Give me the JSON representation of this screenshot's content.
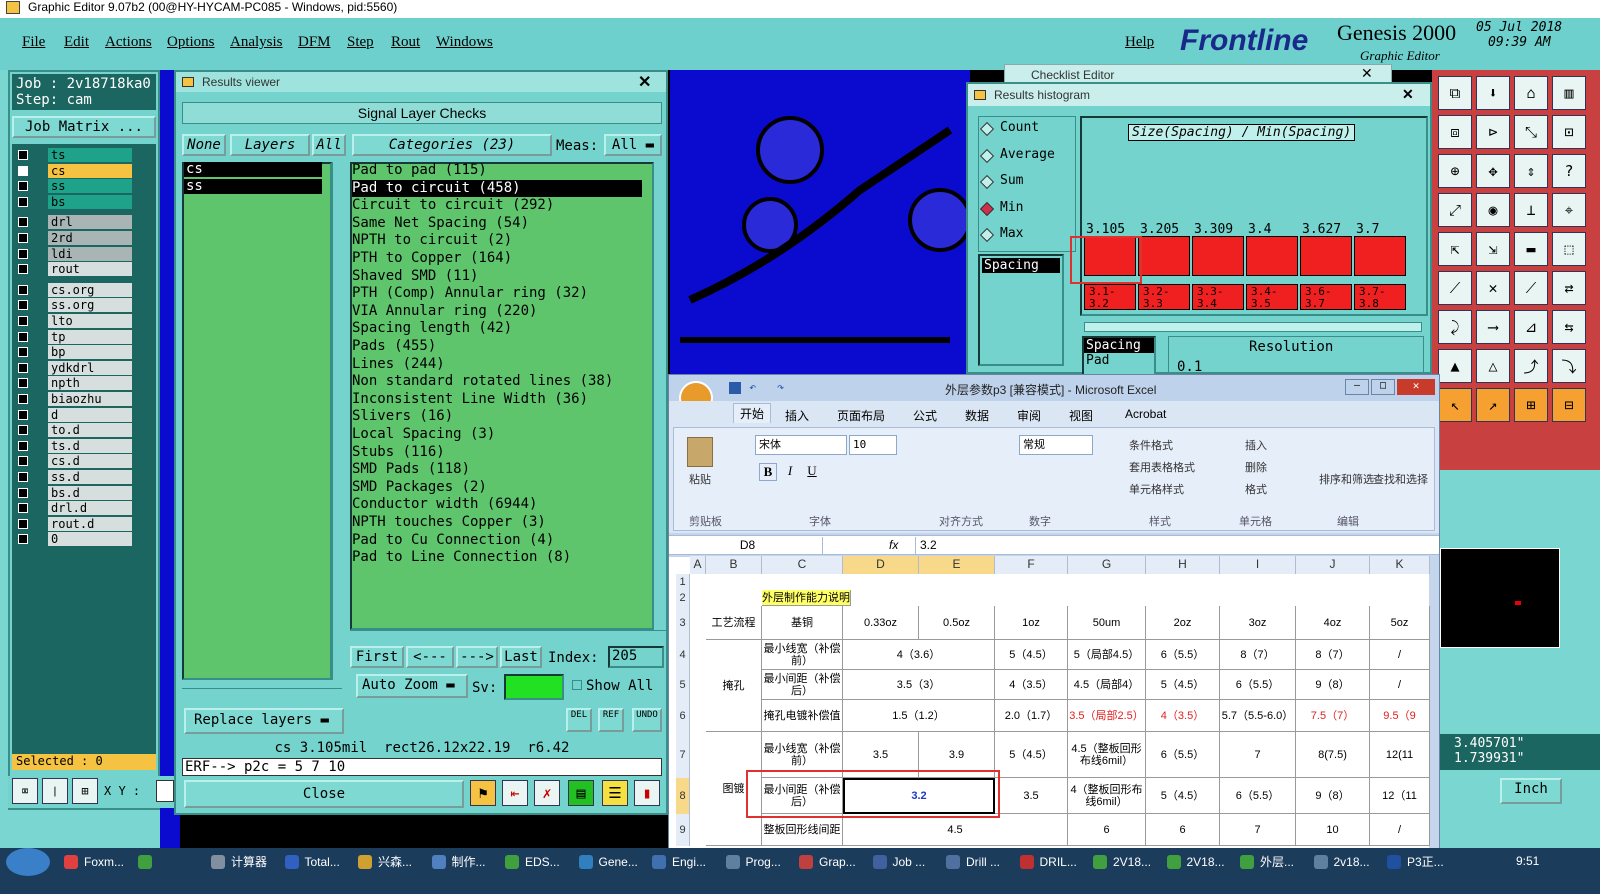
{
  "titlebar": {
    "text": "Graphic Editor 9.07b2 (00@HY-HYCAM-PC085 - Windows, pid:5560)"
  },
  "menu": {
    "items": [
      "File",
      "Edit",
      "Actions",
      "Options",
      "Analysis",
      "DFM",
      "Step",
      "Rout",
      "Windows"
    ],
    "help": "Help"
  },
  "brand": {
    "logo": "Frontline",
    "product": "Genesis 2000",
    "sub": "Graphic Editor",
    "date": "05 Jul 2018",
    "time": "09:39 AM"
  },
  "job": {
    "job_label": "Job : 2v18718ka0",
    "step_label": "Step: cam",
    "matrix_btn": "Job Matrix ...",
    "selected": "Selected : 0",
    "xy": "X Y :"
  },
  "layers": [
    {
      "name": "ts",
      "color": "#1fa28a"
    },
    {
      "name": "cs",
      "color": "#f5c242"
    },
    {
      "name": "ss",
      "color": "#1fa28a"
    },
    {
      "name": "bs",
      "color": "#1fa28a"
    },
    {
      "name": "drl",
      "color": "#a9b4b4"
    },
    {
      "name": "2rd",
      "color": "#a9b4b4"
    },
    {
      "name": "ldi",
      "color": "#a9b4b4"
    },
    {
      "name": "rout",
      "color": "#d6dede"
    },
    {
      "name": "cs.org",
      "color": "#d6dede"
    },
    {
      "name": "ss.org",
      "color": "#d6dede"
    },
    {
      "name": "lto",
      "color": "#d6dede"
    },
    {
      "name": "tp",
      "color": "#d6dede"
    },
    {
      "name": "bp",
      "color": "#d6dede"
    },
    {
      "name": "ydkdrl",
      "color": "#d6dede"
    },
    {
      "name": "npth",
      "color": "#d6dede"
    },
    {
      "name": "biaozhu",
      "color": "#d6dede"
    },
    {
      "name": "d",
      "color": "#d6dede"
    },
    {
      "name": "to.d",
      "color": "#d6dede"
    },
    {
      "name": "ts.d",
      "color": "#d6dede"
    },
    {
      "name": "cs.d",
      "color": "#d6dede"
    },
    {
      "name": "ss.d",
      "color": "#d6dede"
    },
    {
      "name": "bs.d",
      "color": "#d6dede"
    },
    {
      "name": "drl.d",
      "color": "#d6dede"
    },
    {
      "name": "rout.d",
      "color": "#d6dede"
    },
    {
      "name": "0",
      "color": "#d6dede"
    }
  ],
  "results": {
    "title": "Results viewer",
    "heading": "Signal Layer Checks",
    "none_btn": "None",
    "layers_btn": "Layers",
    "all_btn": "All",
    "categories_btn": "Categories (23)",
    "meas_label": "Meas:",
    "meas_value": "All",
    "layer_list": [
      "cs",
      "ss"
    ],
    "categories": [
      "Pad to pad (115)",
      "Pad to circuit (458)",
      "Circuit to circuit (292)",
      "Same Net Spacing (54)",
      "NPTH to circuit (2)",
      "PTH to Copper (164)",
      "Shaved SMD (11)",
      "PTH (Comp) Annular ring (32)",
      "VIA Annular ring (220)",
      "Spacing length (42)",
      "Pads (455)",
      "Lines (244)",
      "Non standard rotated lines (38)",
      "Inconsistent Line Width (36)",
      "Slivers (16)",
      "Local Spacing (3)",
      "Stubs (116)",
      "SMD Pads (118)",
      "SMD Packages (2)",
      "Conductor width (6944)",
      "NPTH touches Copper (3)",
      "Pad to Cu Connection (4)",
      "Pad to Line Connection (8)"
    ],
    "first": "First",
    "prev": "<---",
    "next": "--->",
    "last": "Last",
    "index_label": "Index:",
    "index_value": "205",
    "auto_zoom": "Auto Zoom",
    "sv": "Sv:",
    "show_all": "Show All",
    "replace_layers": "Replace layers",
    "status": "cs 3.105mil  rect26.12x22.19  r6.42",
    "erf": "ERF--> p2c = 5 7 10",
    "close": "Close",
    "del": "DEL",
    "ref": "REF",
    "undo": "UNDO"
  },
  "checklist": {
    "title": "Checklist Editor"
  },
  "histogram": {
    "title": "Results histogram",
    "options": [
      "Count",
      "Average",
      "Sum",
      "Min",
      "Max"
    ],
    "selected": "Min",
    "graph_title": "Size(Spacing) / Min(Spacing)",
    "list_item": "Spacing",
    "bars": [
      {
        "value": "3.105",
        "range": "3.1- 3.2"
      },
      {
        "value": "3.205",
        "range": "3.2- 3.3"
      },
      {
        "value": "3.309",
        "range": "3.3- 3.4"
      },
      {
        "value": "3.4",
        "range": "3.4- 3.5"
      },
      {
        "value": "3.627",
        "range": "3.6- 3.7"
      },
      {
        "value": "3.7",
        "range": "3.7- 3.8"
      }
    ],
    "list2": [
      "Spacing",
      "Pad"
    ],
    "resolution": "Resolution",
    "res_value": "0.1"
  },
  "excel": {
    "title": "外层参数p3 [兼容模式] - Microsoft Excel",
    "tabs": [
      "开始",
      "插入",
      "页面布局",
      "公式",
      "数据",
      "审阅",
      "视图",
      "Acrobat"
    ],
    "font": "宋体",
    "size": "10",
    "number_format": "常规",
    "groups": [
      "剪贴板",
      "字体",
      "对齐方式",
      "数字",
      "样式",
      "单元格",
      "编辑"
    ],
    "ribbon_btns": {
      "paste": "粘贴",
      "cond": "条件格式",
      "table": "套用表格格式",
      "cellstyle": "单元格样式",
      "insert": "插入",
      "delete": "删除",
      "format": "格式",
      "sort": "排序和筛选",
      "find": "查找和选择"
    },
    "name_box": "D8",
    "formula": "3.2",
    "fx": "fx",
    "cols": [
      "A",
      "B",
      "C",
      "D",
      "E",
      "F",
      "G",
      "H",
      "I",
      "J",
      "K"
    ],
    "rows": [
      "1",
      "2",
      "3",
      "4",
      "5",
      "6",
      "7",
      "8",
      "9"
    ],
    "table_title": "外层制作能力说明",
    "hdr": [
      "工艺流程",
      "基铜",
      "0.33oz",
      "0.5oz",
      "1oz",
      "50um",
      "2oz",
      "3oz",
      "4oz",
      "5oz"
    ],
    "r4": [
      "最小线宽（补偿前）",
      "4（3.6）",
      "5（4.5）",
      "5（局部4.5）",
      "6（5.5）",
      "8（7）",
      "8（7）",
      "/"
    ],
    "r5": [
      "最小间距（补偿后）",
      "3.5（3）",
      "4（3.5）",
      "4.5（局部4）",
      "5（4.5）",
      "6（5.5）",
      "9（8）",
      "/"
    ],
    "r6": [
      "掩孔电镀补偿值",
      "1.5（1.2）",
      "2.0（1.7）",
      "3.5（局部2.5）",
      "4（3.5）",
      "5.7（5.5-6.0）",
      "7.5（7）",
      "9.5（9"
    ],
    "b_mask": "掩孔",
    "b_graph": "图镀",
    "r7": [
      "最小线宽（补偿前）",
      "3.5",
      "3.9",
      "5（4.5）",
      "4.5（整板回形布线6mil）",
      "6（5.5）",
      "7",
      "8(7.5)",
      "12(11"
    ],
    "r8": [
      "最小间距（补偿后）",
      "3.2",
      "3.5",
      "4（整板回形布线6mil）",
      "5（4.5）",
      "6（5.5）",
      "9（8）",
      "12（11"
    ],
    "r9": [
      "整板回形线间距",
      "4.5",
      "6",
      "6",
      "7",
      "10",
      "/"
    ]
  },
  "coords": {
    "x": "3.405701\"",
    "y": "1.739931\"",
    "unit": "Inch"
  },
  "taskbar": {
    "items": [
      "Foxm...",
      "",
      "计算器",
      "Total...",
      "兴森...",
      "制作...",
      "EDS...",
      "Gene...",
      "Engi...",
      "Prog...",
      "Grap...",
      "Job ...",
      "Drill ...",
      "DRIL...",
      "2V18...",
      "2V18...",
      "外层...",
      "2v18...",
      "P3正..."
    ],
    "time": "9:51"
  }
}
